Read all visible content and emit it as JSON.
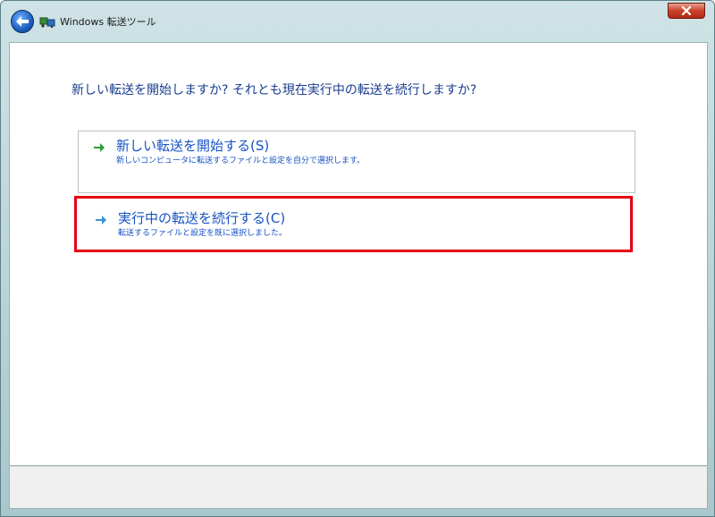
{
  "window": {
    "title": "Windows 転送ツール"
  },
  "main": {
    "heading": "新しい転送を開始しますか? それとも現在実行中の転送を続行しますか?",
    "options": [
      {
        "title": "新しい転送を開始する(S)",
        "description": "新しいコンピュータに転送するファイルと設定を自分で選択します。"
      },
      {
        "title": "実行中の転送を続行する(C)",
        "description": "転送するファイルと設定を既に選択しました。"
      }
    ]
  },
  "colors": {
    "link": "#1753c4",
    "highlight_border": "#e60012",
    "heading": "#1a3d8f"
  },
  "icons": {
    "back": "back-arrow-icon",
    "app": "transfer-icon",
    "close": "close-icon",
    "option_arrow": "green-arrow-icon"
  }
}
